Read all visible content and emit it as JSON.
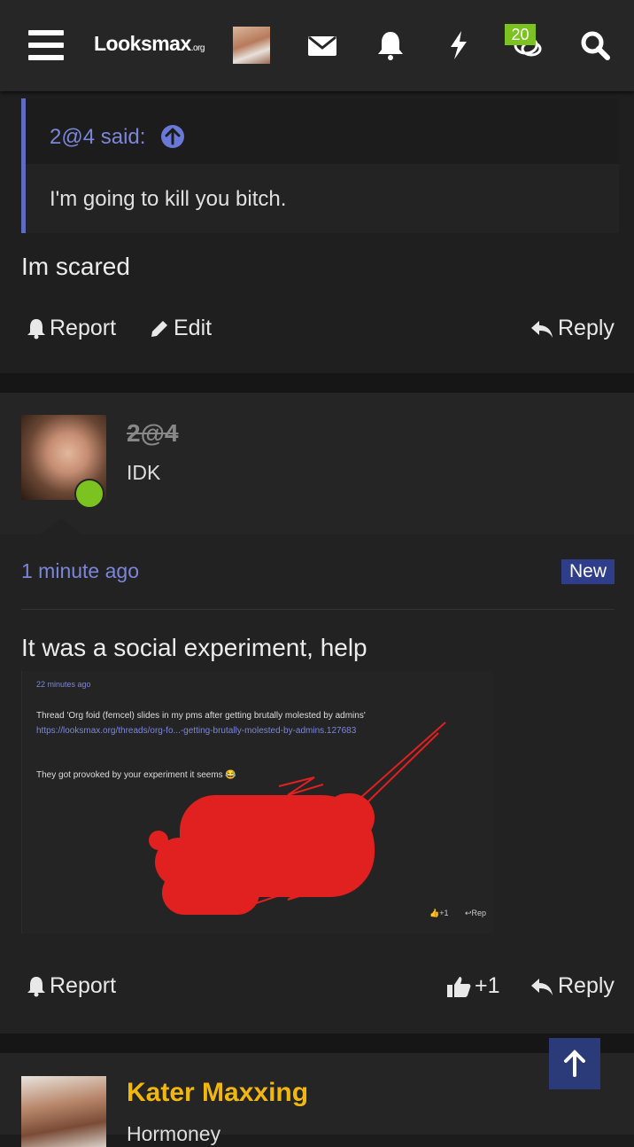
{
  "header": {
    "logo": "Looksmax",
    "logo_suffix": ".org",
    "alerts_badge": "20"
  },
  "post_reply": {
    "quote_author": "2@4 said:",
    "quote_text": "I'm going to kill you bitch.",
    "message": "Im scared",
    "actions": {
      "report": "Report",
      "edit": "Edit",
      "reply": "Reply"
    }
  },
  "post_main": {
    "username": "2@4",
    "user_title": "IDK",
    "timestamp": "1 minute ago",
    "new_label": "New",
    "message": "It was a social experiment, help",
    "screenshot": {
      "time": "22 minutes ago",
      "line1": "Thread 'Org foid (femcel) slides in my pms after getting brutally molested by admins'",
      "link": "https://looksmax.org/threads/org-fo...-getting-brutally-molested-by-admins.127683",
      "line2": "They got provoked by your experiment it seems 😂",
      "mini_like": "+1",
      "mini_reply": "Rep"
    },
    "actions": {
      "report": "Report",
      "like_count": "+1",
      "reply": "Reply"
    }
  },
  "post_next": {
    "username": "Kater Maxxing",
    "user_title": "Hormoney"
  },
  "colors": {
    "accent": "#7c86d8",
    "quote_bar": "#5d6cbf",
    "online": "#7cc221",
    "username_gold": "#f2b70c",
    "new_badge": "#2f3e8a"
  }
}
